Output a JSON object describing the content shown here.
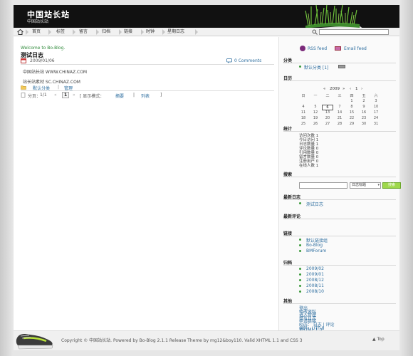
{
  "header": {
    "title": "中国站长站",
    "subtitle": "中国站长站"
  },
  "nav": {
    "items": [
      "首页",
      "标签",
      "留言",
      "归档",
      "链接",
      "时钟",
      "星期日志"
    ]
  },
  "post": {
    "welcome": "Welcome to Bo-Blog.",
    "title": "测试日志",
    "date": "2009/01/06",
    "comments": "0 Comments",
    "body_line1": "中国站长站  WWW.CHINAZ.COM",
    "body_line2": "站长站素材  SC.CHINAZ.COM",
    "category": "默认分类",
    "manage": "管理",
    "cat_sep": "|"
  },
  "pager": {
    "label": "分页：",
    "pages": "1/1",
    "current": "1",
    "display_label": "[ 显示模式：",
    "mode_summary": "摘要",
    "mode_list": "列表",
    "bracket_close": "]",
    "pipe": "|"
  },
  "sidebar": {
    "rss": "RSS feed",
    "email": "Email feed",
    "category_title": "分类",
    "category_item": "默认分类  [1]",
    "calendar_title": "日历",
    "calendar_month": "2009",
    "calendar_mon": "1",
    "calendar_prev_year": "«",
    "calendar_next_year": "»",
    "calendar_prev_mon": "‹",
    "calendar_next_mon": "›",
    "weekdays": [
      "日",
      "一",
      "二",
      "三",
      "四",
      "五",
      "六"
    ],
    "weeks": [
      [
        "",
        "",
        "",
        "",
        "1",
        "2",
        "3"
      ],
      [
        "4",
        "5",
        "6",
        "7",
        "8",
        "9",
        "10"
      ],
      [
        "11",
        "12",
        "13",
        "14",
        "15",
        "16",
        "17"
      ],
      [
        "18",
        "19",
        "20",
        "21",
        "22",
        "23",
        "24"
      ],
      [
        "25",
        "26",
        "27",
        "28",
        "29",
        "30",
        "31"
      ]
    ],
    "stats_title": "统计",
    "stats": [
      "访问次数  1",
      "今日访问  1",
      "日志数量  1",
      "评论数量  0",
      "引用数量  0",
      "留言数量  0",
      "注册用户  0",
      "在线人数  1"
    ],
    "search_title": "搜索",
    "search_select": "日志标题",
    "search_button": "搜索",
    "recent_title": "最新日志",
    "recent_item": "测试日志",
    "comments_title": "最新评论",
    "links_title": "链接",
    "links": [
      "默认链接组",
      "Bo-Blog",
      "BMForum"
    ],
    "archive_title": "归档",
    "archives": [
      "2009/02",
      "2009/01",
      "2008/12",
      "2008/11",
      "2008/10"
    ],
    "misc_title": "其他",
    "misc": [
      "登出",
      "修改资料",
      "进入管理",
      "撰写日志",
      "申请链接",
      "RSS： 日志 | 评论",
      "编码：UTF-8",
      "XHTML 1.0"
    ]
  },
  "footer": {
    "text": "Copyright © 中国站长站. Powered by Bo-Blog 2.1.1 Release  Theme by mg12&boy110. Valid XHTML 1.1 and CSS 3",
    "top": "▲ Top"
  },
  "colors": {
    "accent_green": "#3a9a3a",
    "link_blue": "#2f6fa0",
    "header_bg": "#111111"
  }
}
